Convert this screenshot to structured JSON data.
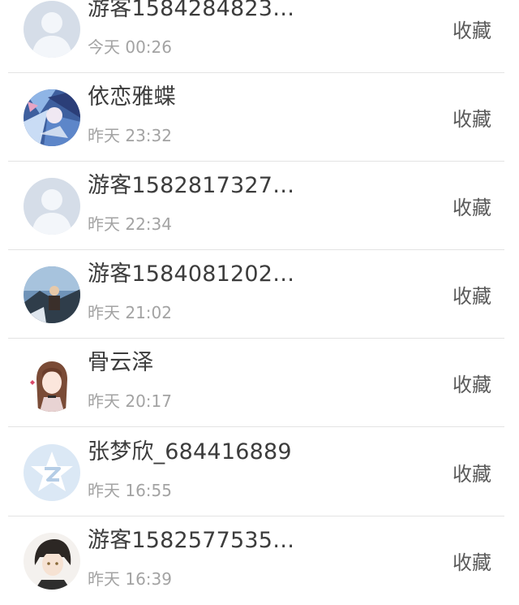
{
  "colors": {
    "background": "#ffffff",
    "name_text": "#3c3c3c",
    "time_text": "#a3a3a3",
    "action_text": "#5a5a5a",
    "divider": "#e3e3e3"
  },
  "rows": [
    {
      "name": "游客1584284823…",
      "time": "今天 00:26",
      "action": "收藏",
      "avatar": "default-person-avatar"
    },
    {
      "name": "依恋雅蝶",
      "time": "昨天 23:32",
      "action": "收藏",
      "avatar": "anime-art-avatar"
    },
    {
      "name": "游客1582817327…",
      "time": "昨天 22:34",
      "action": "收藏",
      "avatar": "default-person-avatar"
    },
    {
      "name": "游客1584081202…",
      "time": "昨天 21:02",
      "action": "收藏",
      "avatar": "photo-scene-avatar"
    },
    {
      "name": "骨云泽",
      "time": "昨天 20:17",
      "action": "收藏",
      "avatar": "anime-girl-avatar"
    },
    {
      "name": "张梦欣_684416889",
      "time": "昨天 16:55",
      "action": "收藏",
      "avatar": "qzone-star-avatar"
    },
    {
      "name": "游客1582577535…",
      "time": "昨天 16:39",
      "action": "收藏",
      "avatar": "anime-boy-avatar"
    }
  ]
}
